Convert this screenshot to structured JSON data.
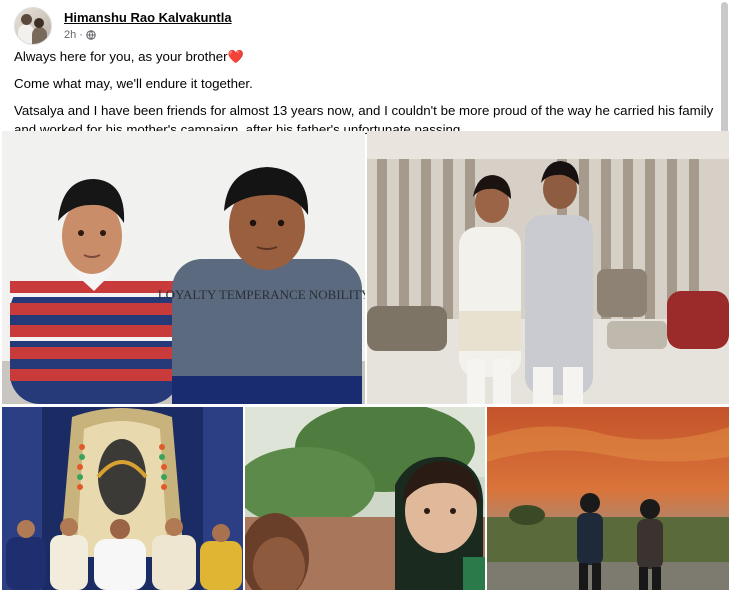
{
  "post": {
    "author": "Himanshu Rao Kalvakuntla",
    "time": "2h",
    "separator": "·",
    "privacy_icon": "globe-icon",
    "text_line1": "Always here for you, as your brother",
    "heart": "❤️",
    "text_line2": "Come what may, we'll endure it together.",
    "text_line3": "Vatsalya and I have been friends for almost 13 years now, and I couldn't be more proud of the way he carried his family and worked for his mother's campaign, after his father's unfortunate passing."
  },
  "photos": {
    "photo1_shirt_text": "LOYALTY TEMPERANCE NOBILITY",
    "colors": {
      "author_link": "#050505",
      "secondary_text": "#65676b",
      "heart": "#e41e3f"
    }
  }
}
